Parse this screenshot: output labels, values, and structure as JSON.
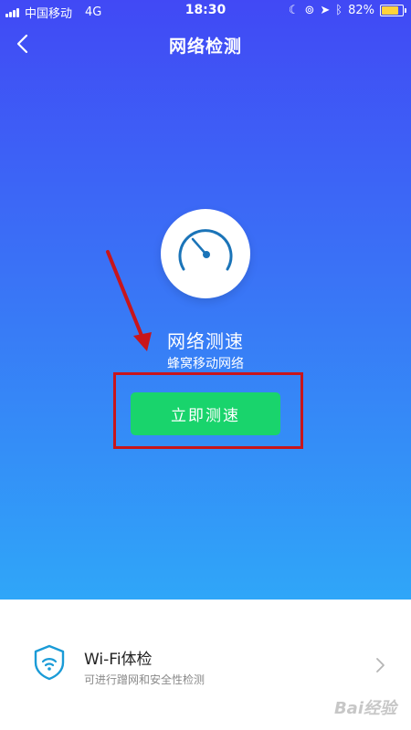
{
  "status_bar": {
    "carrier": "中国移动",
    "network": "4G",
    "time": "18:30",
    "battery": "82%",
    "battery_level": 0.82
  },
  "nav": {
    "title": "网络检测",
    "back_icon": "chevron-left-icon"
  },
  "speed_test": {
    "icon": "speedometer-icon",
    "title": "网络测速",
    "subtitle": "蜂窝移动网络",
    "button_label": "立即测速"
  },
  "wifi_check": {
    "icon": "wifi-shield-icon",
    "title": "Wi-Fi体检",
    "subtitle": "可进行蹭网和安全性检测"
  },
  "watermark": "Bai经验",
  "colors": {
    "gradient_top": "#4149f5",
    "gradient_bottom": "#2fa6f8",
    "button_green": "#19d46c",
    "annotation_red": "#c8151b",
    "gauge_blue": "#1b74b8"
  }
}
